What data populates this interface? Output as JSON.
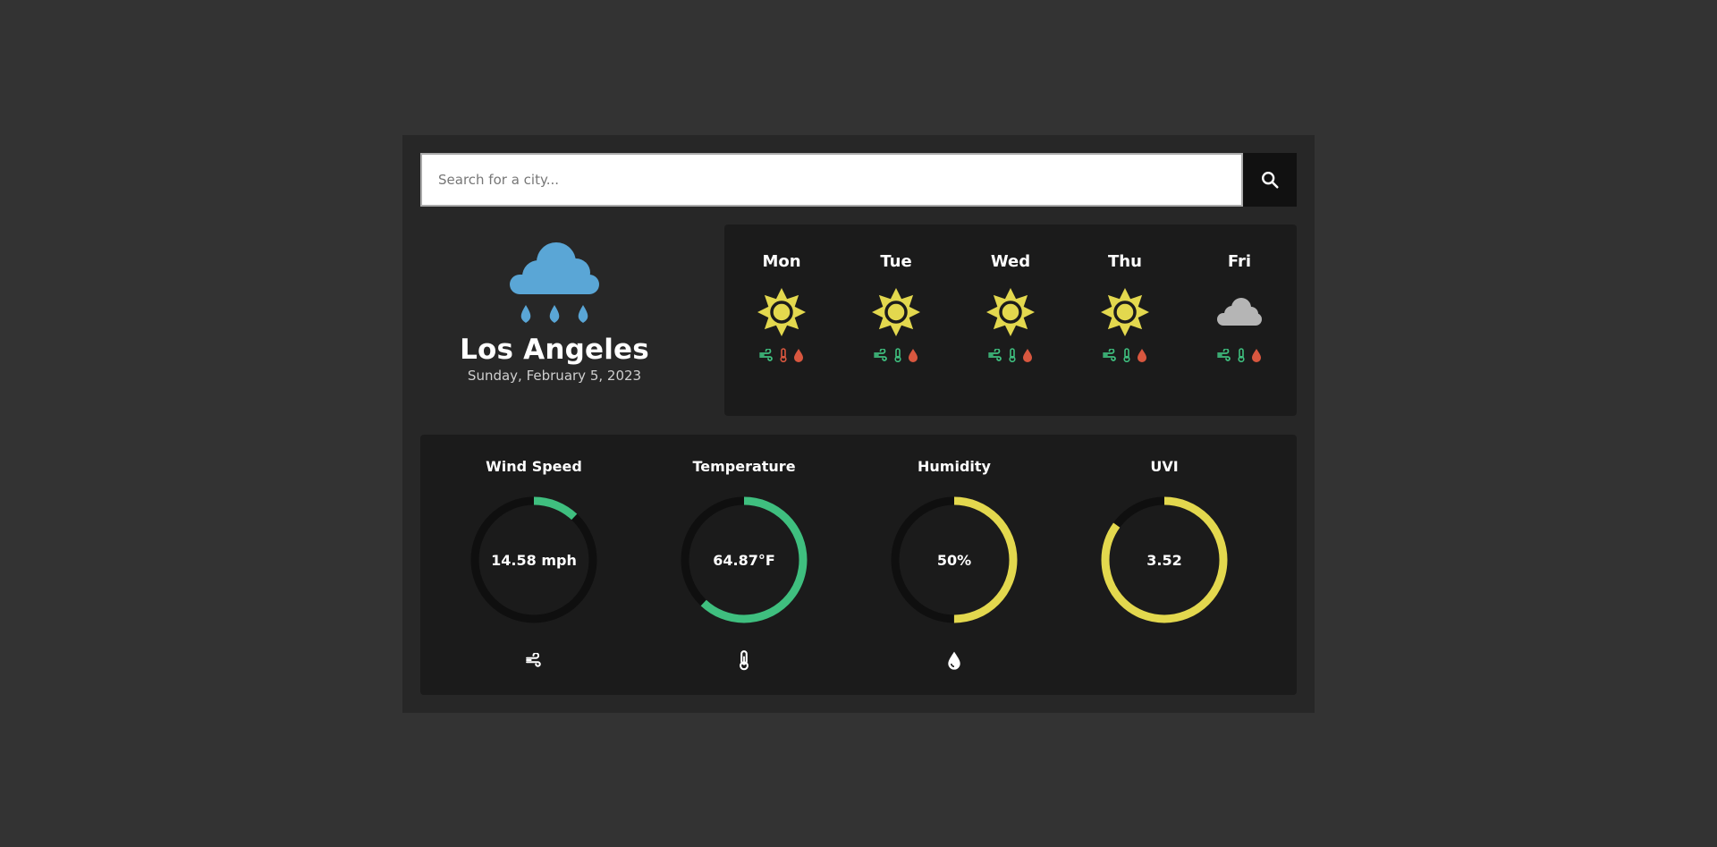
{
  "search": {
    "placeholder": "Search for a city..."
  },
  "current": {
    "icon": "rain-cloud-icon",
    "city": "Los Angeles",
    "date": "Sunday, February 5, 2023"
  },
  "forecast": [
    {
      "day": "Mon",
      "icon": "sun-icon"
    },
    {
      "day": "Tue",
      "icon": "sun-icon"
    },
    {
      "day": "Wed",
      "icon": "sun-icon"
    },
    {
      "day": "Thu",
      "icon": "sun-icon"
    },
    {
      "day": "Fri",
      "icon": "cloud-icon"
    }
  ],
  "metrics": [
    {
      "title": "Wind Speed",
      "value": "14.58 mph",
      "fraction": 0.12,
      "color": "#3fbf7f",
      "icon": "wind-icon"
    },
    {
      "title": "Temperature",
      "value": "64.87°F",
      "fraction": 0.62,
      "color": "#3fbf7f",
      "icon": "thermometer-icon"
    },
    {
      "title": "Humidity",
      "value": "50%",
      "fraction": 0.5,
      "color": "#e3d84e",
      "icon": "droplet-icon"
    },
    {
      "title": "UVI",
      "value": "3.52",
      "fraction": 0.85,
      "color": "#e3d84e",
      "icon": ""
    }
  ],
  "colors": {
    "green": "#3fbf7f",
    "yellow": "#e3d84e",
    "red": "#d9573f",
    "rain_blue": "#5aa6d6",
    "cloud_gray": "#b5b5b5",
    "track": "#0f0f0f"
  }
}
